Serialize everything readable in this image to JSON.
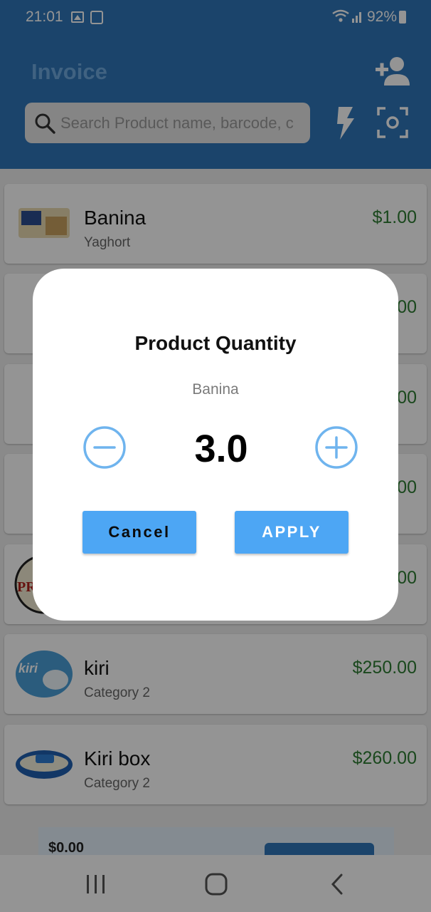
{
  "status_bar": {
    "time": "21:01",
    "battery": "92%"
  },
  "header": {
    "title": "Invoice",
    "search_placeholder": "Search Product name, barcode, c"
  },
  "products": [
    {
      "name": "Banina",
      "category": "Yaghort",
      "price": "$1.00"
    },
    {
      "name": "",
      "category": "",
      "price": "$1.00"
    },
    {
      "name": "",
      "category": "",
      "price": "$1.00"
    },
    {
      "name": "",
      "category": "",
      "price": "$1.00"
    },
    {
      "name": "",
      "category": "",
      "price": "$1.00"
    },
    {
      "name": "kiri",
      "category": "Category 2",
      "price": "$250.00"
    },
    {
      "name": "Kiri box",
      "category": "Category 2",
      "price": "$260.00"
    }
  ],
  "summary": {
    "total": "$0.00"
  },
  "dialog": {
    "title": "Product Quantity",
    "product": "Banina",
    "quantity": "3.0",
    "cancel_label": "Cancel",
    "apply_label": "APPLY"
  },
  "colors": {
    "primary": "#2F76B8",
    "accent": "#4DA6F4",
    "price": "#2E7D32"
  }
}
